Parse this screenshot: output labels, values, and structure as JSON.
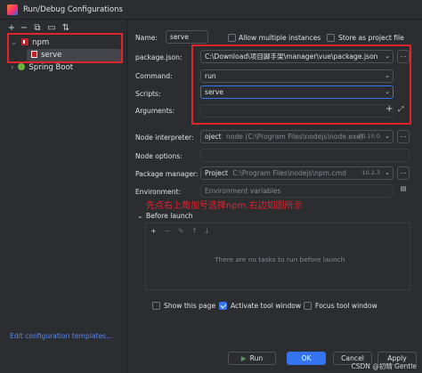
{
  "window": {
    "title": "Run/Debug Configurations"
  },
  "left_toolbar": {
    "icons": [
      "+",
      "−",
      "⧉",
      "▭",
      "⇅"
    ]
  },
  "tree": {
    "npm_label": "npm",
    "npm_child_label": "serve",
    "spring_boot_label": "Spring Boot"
  },
  "edit_templates_link": "Edit configuration templates...",
  "form": {
    "name_label": "Name:",
    "name_value": "serve",
    "allow_multiple_label": "Allow multiple instances",
    "store_as_file_label": "Store as project file",
    "package_json_label": "package.json:",
    "package_json_value": "C:\\Download\\项目脚手架\\manager\\vue\\package.json",
    "command_label": "Command:",
    "command_value": "run",
    "scripts_label": "Scripts:",
    "scripts_value": "serve",
    "arguments_label": "Arguments:",
    "node_interpreter_label": "Node interpreter:",
    "node_interpreter_value": "oject",
    "node_interpreter_path": "node (C:\\Program Files\\nodejs\\node.exe)",
    "node_interpreter_version": "20.10.0",
    "node_options_label": "Node options:",
    "package_manager_label": "Package manager:",
    "package_manager_value": "Project",
    "package_manager_path": "C:\\Program Files\\nodejs\\npm.cmd",
    "package_manager_version": "10.2.3",
    "environment_label": "Environment:",
    "environment_placeholder": "Environment variables"
  },
  "annotation": "先点右上角加号选择npm,右边如图所示",
  "before_launch": {
    "title": "Before launch",
    "empty_text": "There are no tasks to run before launch",
    "tools": [
      "+",
      "−",
      "✎",
      "↑",
      "↓"
    ]
  },
  "options": {
    "show_page_label": "Show this page",
    "activate_tool_label": "Activate tool window",
    "focus_tool_label": "Focus tool window"
  },
  "buttons": {
    "run": "Run",
    "ok": "OK",
    "cancel": "Cancel",
    "apply": "Apply"
  },
  "watermark": "CSDN @初晴 Gentle"
}
